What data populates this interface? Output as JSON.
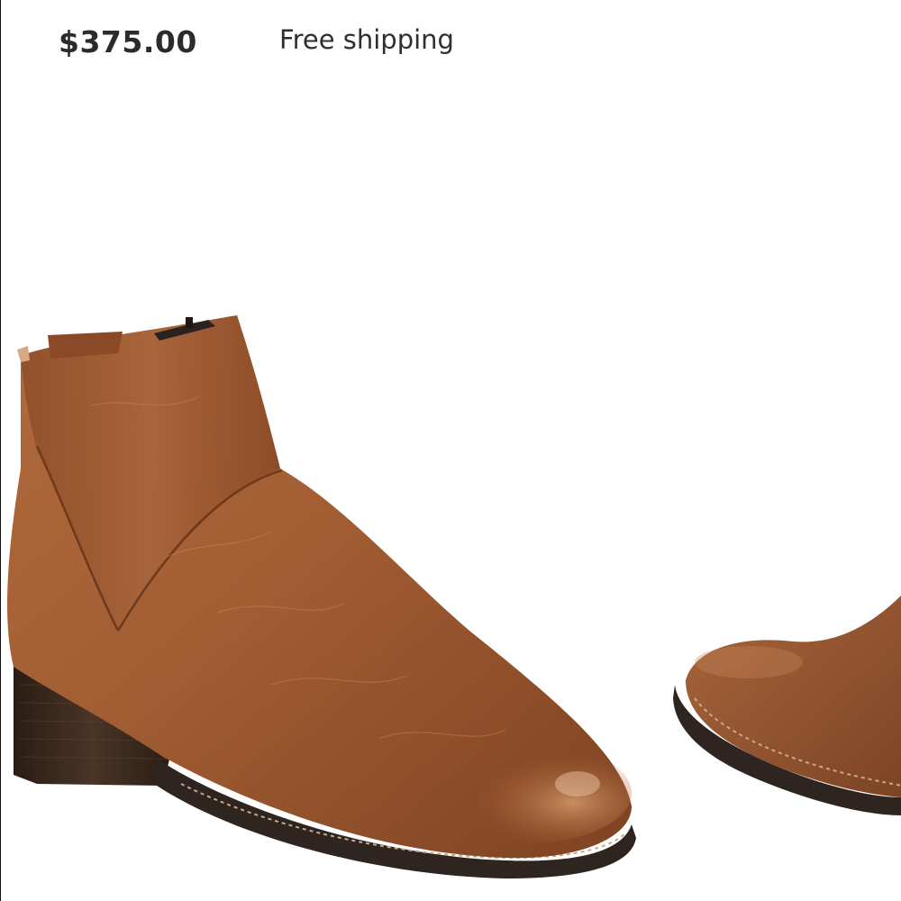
{
  "listing": {
    "price": "$375.00",
    "shipping": "Free shipping"
  },
  "image": {
    "subject": "brown-leather-ankle-boots",
    "colors": {
      "leather": "#9a5a34",
      "leather_highlight": "#c98a5e",
      "heel": "#3a2a20",
      "sole": "#2f2520"
    }
  }
}
